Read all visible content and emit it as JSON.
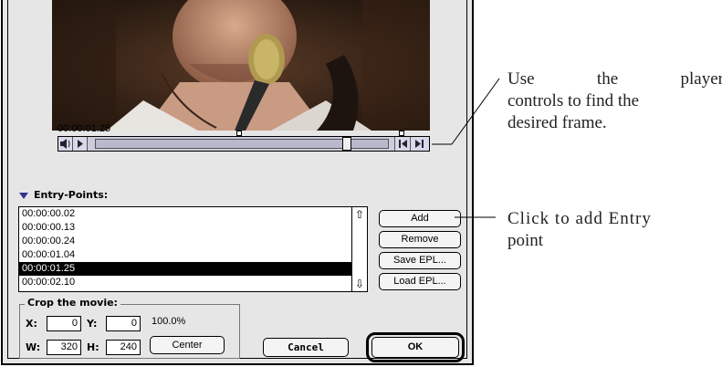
{
  "player": {
    "timecode": "00:00:01.25",
    "position_fraction": 0.87
  },
  "entry_points": {
    "title": "Entry-Points:",
    "items": [
      "00:00:00.02",
      "00:00:00.13",
      "00:00:00.24",
      "00:00:01.04",
      "00:00:01.25",
      "00:00:02.10"
    ],
    "selected_index": 4,
    "buttons": {
      "add": "Add",
      "remove": "Remove",
      "save": "Save EPL...",
      "load": "Load EPL..."
    }
  },
  "crop": {
    "title": "Crop the movie:",
    "x_label": "X:",
    "x_value": "0",
    "y_label": "Y:",
    "y_value": "0",
    "w_label": "W:",
    "w_value": "320",
    "h_label": "H:",
    "h_value": "240",
    "percent": "100.0%",
    "center_label": "Center"
  },
  "dialog": {
    "cancel_label": "Cancel",
    "ok_label": "OK"
  },
  "annotations": {
    "player_note_line1_words": [
      "Use",
      "the",
      "player"
    ],
    "player_note_line2": "controls to find the",
    "player_note_line3": "desired frame.",
    "add_note_line1": "Click to add Entry",
    "add_note_line2": "point"
  },
  "icons": {
    "speaker": "speaker-icon",
    "play": "play-icon",
    "step_back": "step-back-icon",
    "step_forward": "step-forward-icon",
    "scroll_up": "scroll-up-arrow-icon",
    "scroll_down": "scroll-down-arrow-icon",
    "disclosure": "disclosure-triangle-icon"
  },
  "colors": {
    "selection": "#000000",
    "dialog_bg": "#e6e6e6",
    "triangle": "#33338a"
  }
}
